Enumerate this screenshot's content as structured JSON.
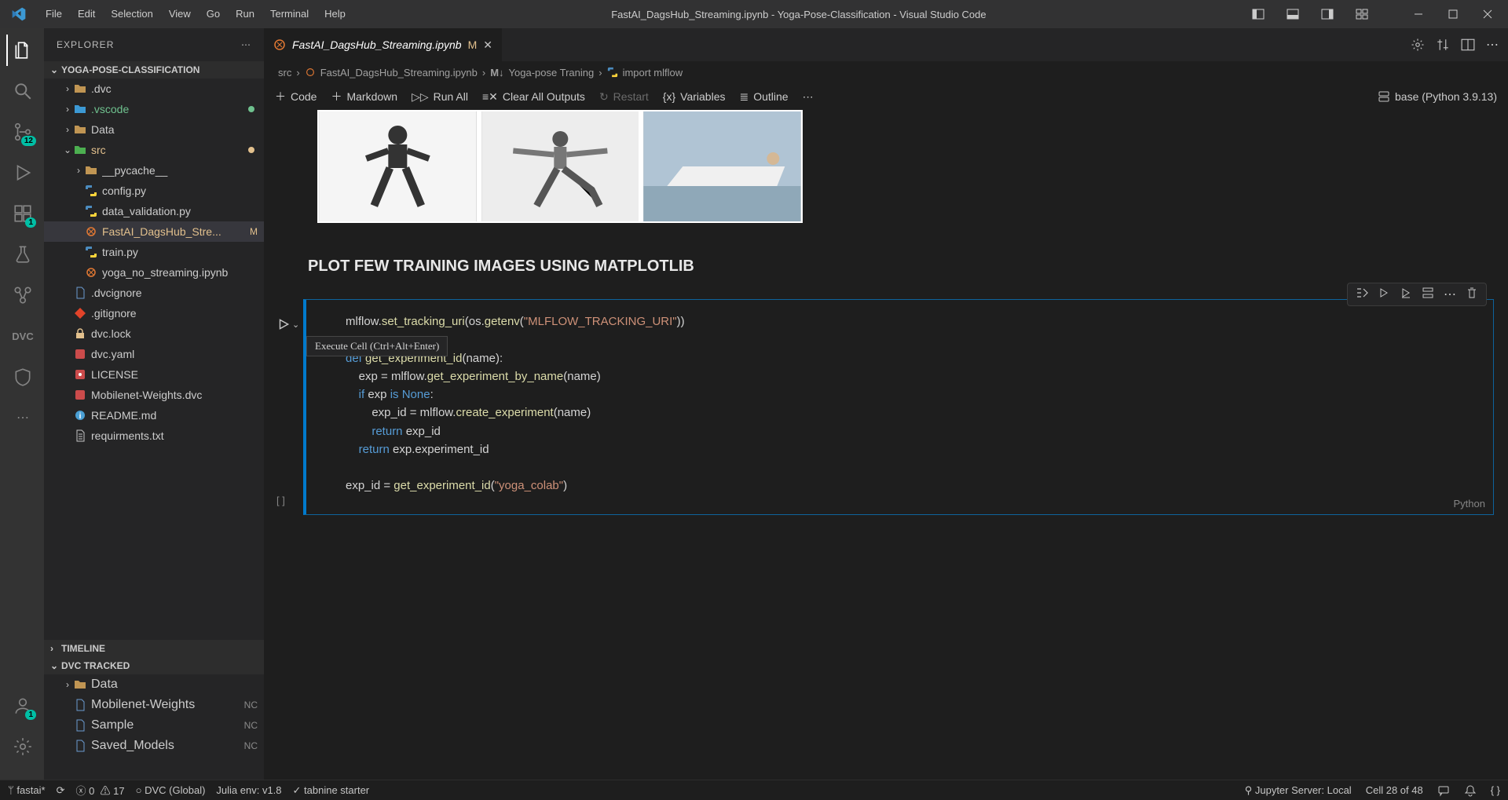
{
  "menubar": {
    "items": [
      "File",
      "Edit",
      "Selection",
      "View",
      "Go",
      "Run",
      "Terminal",
      "Help"
    ],
    "title": "FastAI_DagsHub_Streaming.ipynb - Yoga-Pose-Classification - Visual Studio Code"
  },
  "activitybar": {
    "items": [
      {
        "name": "explorer",
        "active": true
      },
      {
        "name": "search"
      },
      {
        "name": "source-control",
        "badge": "12"
      },
      {
        "name": "run-debug"
      },
      {
        "name": "extensions",
        "badge": "1"
      },
      {
        "name": "testing"
      },
      {
        "name": "remote"
      },
      {
        "name": "dvc"
      },
      {
        "name": "project"
      },
      {
        "name": "overflow"
      }
    ],
    "bottom": [
      {
        "name": "accounts",
        "badge": "1"
      },
      {
        "name": "manage"
      }
    ]
  },
  "sidebar": {
    "title": "EXPLORER",
    "project": "YOGA-POSE-CLASSIFICATION",
    "files": [
      {
        "type": "folder",
        "name": ".dvc",
        "icon": "folder",
        "depth": 1,
        "expanded": false,
        "color": "#c5c5c5"
      },
      {
        "type": "folder",
        "name": ".vscode",
        "icon": "folder-vscode",
        "depth": 1,
        "expanded": false,
        "untracked": true
      },
      {
        "type": "folder",
        "name": "Data",
        "icon": "folder",
        "depth": 1,
        "expanded": false,
        "color": "#dcb67a"
      },
      {
        "type": "folder",
        "name": "src",
        "icon": "folder-src",
        "depth": 1,
        "expanded": true,
        "modified": true
      },
      {
        "type": "folder",
        "name": "__pycache__",
        "icon": "folder",
        "depth": 2,
        "expanded": false,
        "color": "#c5c5c5"
      },
      {
        "type": "file",
        "name": "config.py",
        "icon": "python",
        "depth": 2
      },
      {
        "type": "file",
        "name": "data_validation.py",
        "icon": "python",
        "depth": 2
      },
      {
        "type": "file",
        "name": "FastAI_DagsHub_Stre...",
        "icon": "notebook",
        "depth": 2,
        "active": true,
        "modified": true,
        "decor": "M"
      },
      {
        "type": "file",
        "name": "train.py",
        "icon": "python",
        "depth": 2
      },
      {
        "type": "file",
        "name": "yoga_no_streaming.ipynb",
        "icon": "notebook",
        "depth": 2
      },
      {
        "type": "file",
        "name": ".dvcignore",
        "icon": "file",
        "depth": 1
      },
      {
        "type": "file",
        "name": ".gitignore",
        "icon": "git",
        "depth": 1
      },
      {
        "type": "file",
        "name": "dvc.lock",
        "icon": "lock",
        "depth": 1
      },
      {
        "type": "file",
        "name": "dvc.yaml",
        "icon": "yaml",
        "depth": 1
      },
      {
        "type": "file",
        "name": "LICENSE",
        "icon": "cert",
        "depth": 1
      },
      {
        "type": "file",
        "name": "Mobilenet-Weights.dvc",
        "icon": "yaml",
        "depth": 1
      },
      {
        "type": "file",
        "name": "README.md",
        "icon": "info",
        "depth": 1
      },
      {
        "type": "file",
        "name": "requirments.txt",
        "icon": "txt",
        "depth": 1
      }
    ],
    "sections": {
      "timeline": "TIMELINE",
      "dvc": "DVC TRACKED"
    },
    "dvcTracked": [
      {
        "type": "folder",
        "name": "Data",
        "depth": 1,
        "expanded": false
      },
      {
        "type": "file",
        "name": "Mobilenet-Weights",
        "depth": 1,
        "nc": true,
        "decor": "NC"
      },
      {
        "type": "file",
        "name": "Sample",
        "depth": 1,
        "nc": true,
        "decor": "NC"
      },
      {
        "type": "file",
        "name": "Saved_Models",
        "depth": 1,
        "nc": true,
        "decor": "NC"
      }
    ]
  },
  "tab": {
    "icon": "notebook",
    "label": "FastAI_DagsHub_Streaming.ipynb",
    "decor": "M"
  },
  "breadcrumbs": {
    "parts": [
      "src",
      "FastAI_DagsHub_Streaming.ipynb",
      "Yoga-pose Traning",
      "import mlflow"
    ]
  },
  "nbToolbar": {
    "code": "Code",
    "markdown": "Markdown",
    "runAll": "Run All",
    "clear": "Clear All Outputs",
    "restart": "Restart",
    "variables": "Variables",
    "outline": "Outline",
    "kernel": "base (Python 3.9.13)"
  },
  "notebook": {
    "heading": "PLOT FEW TRAINING IMAGES USING MATPLOTLIB",
    "tooltip": "Execute Cell (Ctrl+Alt+Enter)",
    "execCount": "[ ]",
    "cellLang": "Python",
    "code": {
      "l1a": "mlflow.",
      "l1b": "set_tracking_uri",
      "l1c": "(os.",
      "l1d": "getenv",
      "l1e": "(",
      "l1f": "\"MLFLOW_TRACKING_URI\"",
      "l1g": "))",
      "l2": "",
      "l3a": "def ",
      "l3b": "get_experiment_id",
      "l3c": "(name):",
      "l4a": "    exp = mlflow.",
      "l4b": "get_experiment_by_name",
      "l4c": "(name)",
      "l5a": "    ",
      "l5b": "if",
      "l5c": " exp ",
      "l5c2": "is",
      "l5d": " ",
      "l5e": "None",
      "l5f": ":",
      "l6a": "        exp_id = mlflow.",
      "l6b": "create_experiment",
      "l6c": "(name)",
      "l7a": "        ",
      "l7b": "return",
      "l7c": " exp_id",
      "l8a": "    ",
      "l8b": "return",
      "l8c": " exp.experiment_id",
      "l9": "",
      "l10a": "exp_id = ",
      "l10b": "get_experiment_id",
      "l10c": "(",
      "l10d": "\"yoga_colab\"",
      "l10e": ")"
    }
  },
  "statusbar": {
    "branch": "fastai*",
    "sync": "",
    "errors": "0",
    "warnings": "17",
    "dvc": "DVC (Global)",
    "julia": "Julia env: v1.8",
    "tabnine": "tabnine starter",
    "jupyter": "Jupyter Server: Local",
    "cell": "Cell 28 of 48"
  },
  "images": [
    "pose-goddess",
    "pose-warrior",
    "pose-plank"
  ]
}
